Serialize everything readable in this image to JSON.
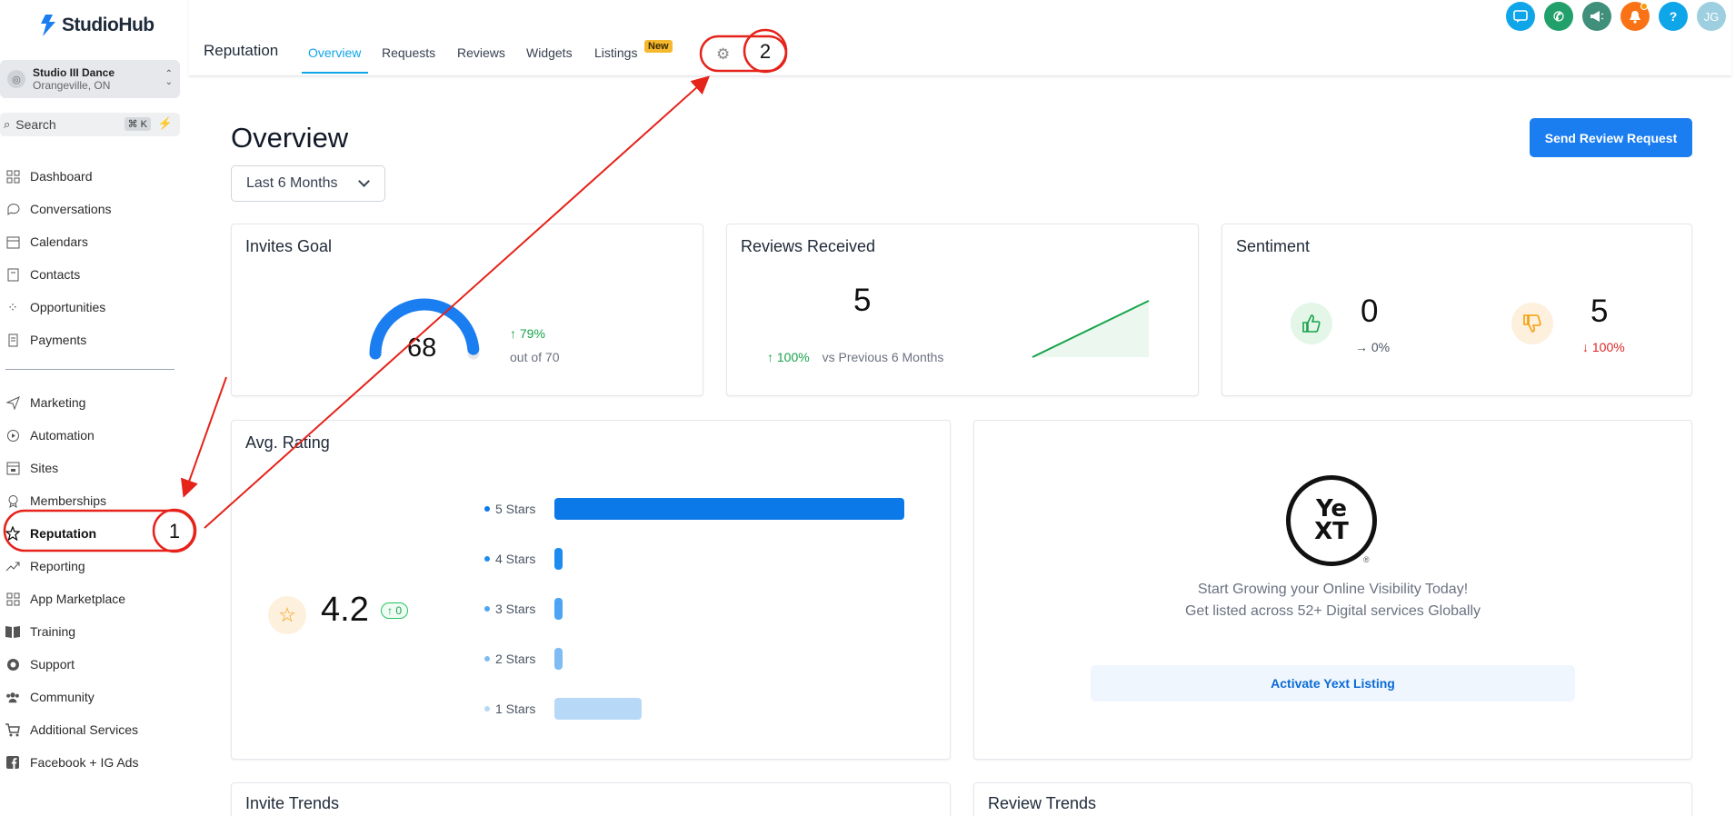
{
  "brand": {
    "name": "StudioHub"
  },
  "account": {
    "name": "Studio III Dance",
    "location": "Orangeville, ON"
  },
  "search": {
    "label": "Search",
    "shortcut": "⌘ K"
  },
  "sidebar": {
    "items": [
      {
        "label": "Dashboard",
        "icon": "dashboard-icon"
      },
      {
        "label": "Conversations",
        "icon": "chat-icon"
      },
      {
        "label": "Calendars",
        "icon": "calendar-icon"
      },
      {
        "label": "Contacts",
        "icon": "contacts-icon"
      },
      {
        "label": "Opportunities",
        "icon": "opportunities-icon"
      },
      {
        "label": "Payments",
        "icon": "payments-icon"
      },
      {
        "label": "Marketing",
        "icon": "send-icon"
      },
      {
        "label": "Automation",
        "icon": "automation-icon"
      },
      {
        "label": "Sites",
        "icon": "sites-icon"
      },
      {
        "label": "Memberships",
        "icon": "badge-icon"
      },
      {
        "label": "Reputation",
        "icon": "star-icon"
      },
      {
        "label": "Reporting",
        "icon": "trend-icon"
      },
      {
        "label": "App Marketplace",
        "icon": "apps-icon"
      },
      {
        "label": "Training",
        "icon": "book-icon"
      },
      {
        "label": "Support",
        "icon": "lifebuoy-icon"
      },
      {
        "label": "Community",
        "icon": "people-icon"
      },
      {
        "label": "Additional Services",
        "icon": "cart-icon"
      },
      {
        "label": "Facebook + IG Ads",
        "icon": "facebook-icon"
      }
    ]
  },
  "header": {
    "title": "Reputation",
    "tabs": [
      "Overview",
      "Requests",
      "Reviews",
      "Widgets",
      "Listings"
    ],
    "new_badge": "New",
    "avatar_initials": "JG",
    "help_label": "?"
  },
  "main": {
    "title": "Overview",
    "period": "Last 6 Months",
    "send_button": "Send Review Request"
  },
  "invites_goal": {
    "title": "Invites Goal",
    "value": "68",
    "change": "79%",
    "out_of": "out of 70",
    "progress": 0.97
  },
  "reviews_received": {
    "title": "Reviews Received",
    "value": "5",
    "change": "100%",
    "comparison": "vs Previous 6 Months"
  },
  "sentiment": {
    "title": "Sentiment",
    "positive_value": "0",
    "positive_pct": "0%",
    "negative_value": "5",
    "negative_pct": "100%"
  },
  "avg_rating": {
    "title": "Avg. Rating",
    "value": "4.2",
    "change": "0",
    "rows": [
      {
        "label": "5 Stars",
        "share": 1.0,
        "color": "#0b7ae8"
      },
      {
        "label": "4 Stars",
        "share": 0.02,
        "color": "#1d8cf0"
      },
      {
        "label": "3 Stars",
        "share": 0.02,
        "color": "#4ca5f2"
      },
      {
        "label": "2 Stars",
        "share": 0.02,
        "color": "#7ebcf3"
      },
      {
        "label": "1 Stars",
        "share": 0.25,
        "color": "#b8d8f8"
      }
    ]
  },
  "yext": {
    "line1": "Start Growing your Online Visibility Today!",
    "line2": "Get listed across 52+ Digital services Globally",
    "button": "Activate Yext Listing",
    "logo_top": "Ye",
    "logo_bottom": "XT"
  },
  "bottom": {
    "invite_trends": "Invite Trends",
    "review_trends": "Review Trends"
  },
  "annotations": {
    "marker1": "1",
    "marker2": "2",
    "color": "#e5231b"
  }
}
